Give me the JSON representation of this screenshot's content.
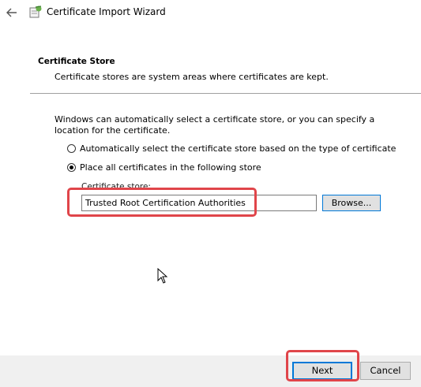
{
  "window": {
    "title": "Certificate Import Wizard"
  },
  "header": {
    "title": "Certificate Store",
    "description": "Certificate stores are system areas where certificates are kept."
  },
  "content": {
    "intro": "Windows can automatically select a certificate store, or you can specify a location for the certificate.",
    "options": [
      {
        "label": "Automatically select the certificate store based on the type of certificate",
        "checked": false
      },
      {
        "label": "Place all certificates in the following store",
        "checked": true
      }
    ],
    "store_label": "Certificate store:",
    "store_value": "Trusted Root Certification Authorities",
    "browse_label": "Browse..."
  },
  "footer": {
    "next_label": "Next",
    "cancel_label": "Cancel"
  },
  "colors": {
    "highlight": "#e0454a",
    "focus_blue": "#0078d7"
  }
}
